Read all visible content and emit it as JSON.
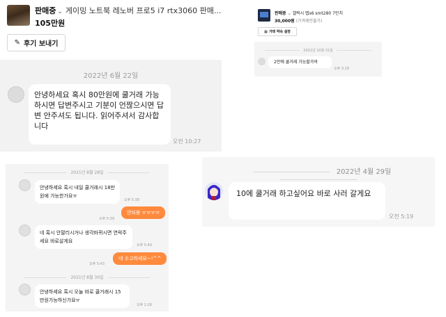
{
  "panel_a": {
    "seller_status": "판매중",
    "product_title": "게이밍 노트북 레노버 프로5 i7 rtx3060 판매...",
    "price": "105만원",
    "review_button": "후기 보내기",
    "date": "2022년 6월 22일",
    "message": "안녕하세요 혹시 80만원에 쿨거래 가능하시면 답변주시고 기분이 언짢으시면 답변 안주셔도 됩니다. 읽어주셔서 감사합니다",
    "time": "오전 10:27"
  },
  "panel_b": {
    "seller_status": "판매중",
    "product_title": "갤럭시 탭s6 smt280 7인치",
    "price": "30,000원",
    "price_note": "(가격제안불가)",
    "promise_button": "거래 약속 설정",
    "date": "2021년 10월 31일",
    "message": "2만에 쿨거래 가능할가여",
    "time": "오후 3:18"
  },
  "panel_c": {
    "date1": "2021년 8월 28일",
    "msg1": "안녕하세요 혹시 내일 쿨거래시 18만원에 가능한가요ㅠ",
    "time1": "오후 5:38",
    "reply1": "안되용 ㅠㅠㅠㅠ",
    "reply1_time": "오후 5:39",
    "msg2": "네 혹시 안팔리시거나 생각바뀌시면 연락주세요 바로살게요",
    "time2": "오후 5:40",
    "reply2": "네 수고하세요~!^^",
    "reply2_time": "오후 5:43",
    "date2": "2021년 8월 30일",
    "msg3": "안녕하세요 혹시 오늘 바로 쿨거래시 15만원가능하신가요ㅠ",
    "time3": "오후 2:26"
  },
  "panel_d": {
    "date": "2022년 4월 29일",
    "message": "10에 쿨거래 하고싶어요 바로 사러 갈게요",
    "time": "오전 5:19"
  },
  "colors": {
    "accent": "#ff8a3d",
    "chat_bg": "#f2f2f2"
  }
}
